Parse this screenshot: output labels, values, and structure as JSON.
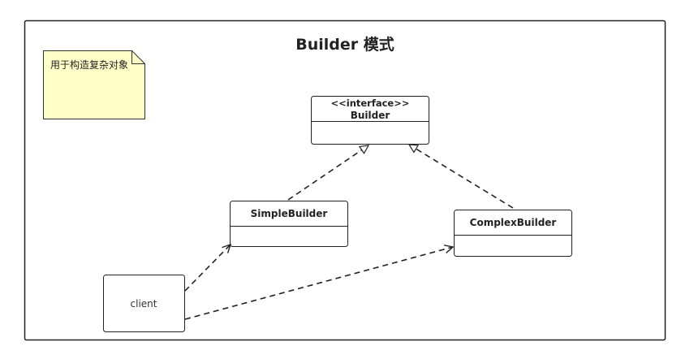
{
  "diagram": {
    "title": "Builder 模式",
    "note": {
      "text": "用于构造复杂对象",
      "fill": "#ffffc8"
    },
    "interface": {
      "stereotype": "<<interface>>",
      "name": "Builder"
    },
    "simple_builder": {
      "name": "SimpleBuilder"
    },
    "complex_builder": {
      "name": "ComplexBuilder"
    },
    "client": {
      "name": "client"
    },
    "colors": {
      "line": "#222222",
      "text": "#222222",
      "note_border": "#333333"
    }
  }
}
